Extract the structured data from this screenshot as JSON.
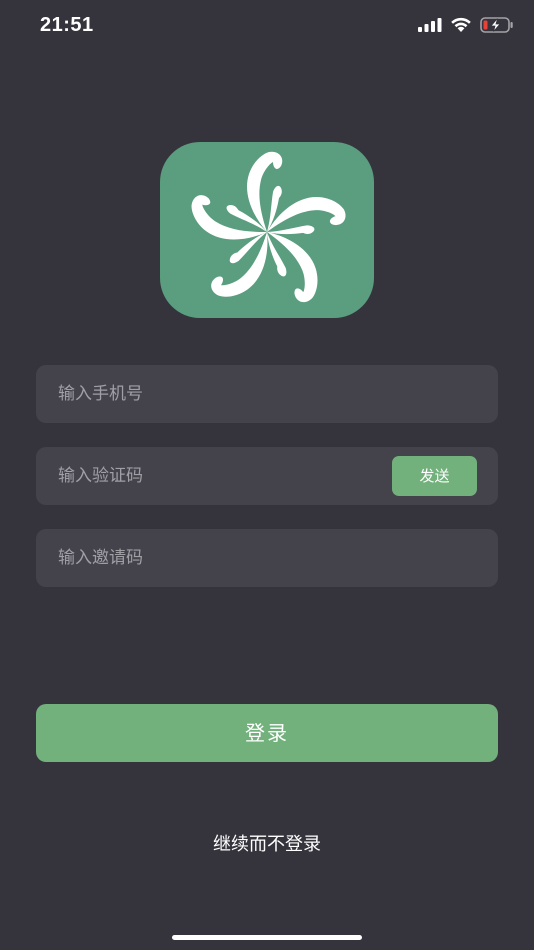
{
  "status_bar": {
    "time": "21:51",
    "icons": [
      "cellular-signal-icon",
      "wifi-icon",
      "battery-charging-icon"
    ]
  },
  "logo": {
    "icon": "flower-logo-icon",
    "colors": {
      "background": "#5a9e7f",
      "mark": "#ffffff"
    }
  },
  "form": {
    "phone_placeholder": "输入手机号",
    "phone_value": "",
    "code_placeholder": "输入验证码",
    "code_value": "",
    "send_label": "发送",
    "invite_placeholder": "输入邀请码",
    "invite_value": ""
  },
  "actions": {
    "login_label": "登录",
    "skip_label": "继续而不登录"
  },
  "colors": {
    "background": "#35343d",
    "field": "#44434c",
    "accent": "#72b07c",
    "placeholder": "#a09fa6"
  }
}
